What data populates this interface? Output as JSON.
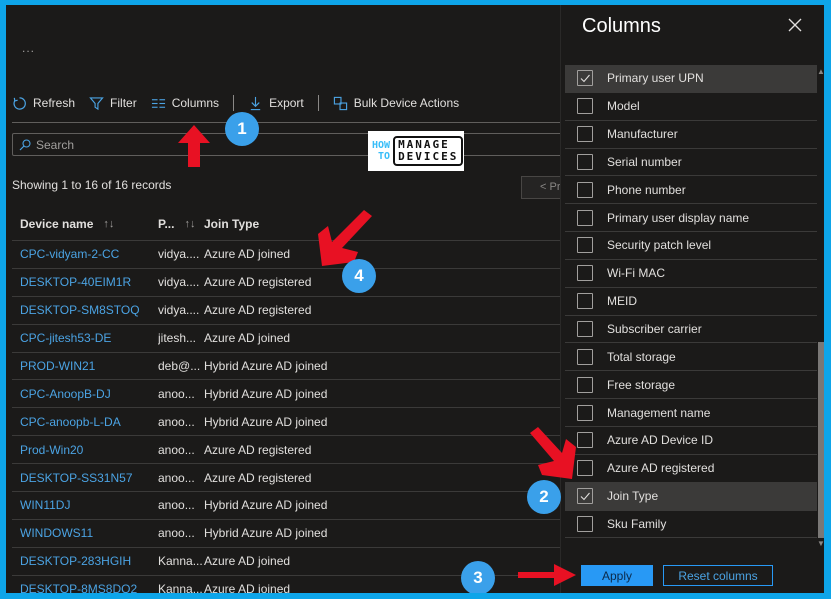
{
  "main": {
    "more_label": "...",
    "toolbar": {
      "refresh": "Refresh",
      "filter": "Filter",
      "columns": "Columns",
      "export": "Export",
      "bulk": "Bulk Device Actions"
    },
    "search_placeholder": "Search",
    "showing": "Showing 1 to 16 of 16 records",
    "prev_label": "< Pre",
    "logo": {
      "how": "HOW",
      "to": "TO",
      "manage": "MANAGE",
      "devices": "DEVICES"
    },
    "table": {
      "headers": [
        "Device name",
        "P...",
        "Join Type"
      ],
      "sort_glyph": "↑↓",
      "rows": [
        {
          "device": "CPC-vidyam-2-CC",
          "user": "vidya....",
          "join": "Azure AD joined"
        },
        {
          "device": "DESKTOP-40EIM1R",
          "user": "vidya....",
          "join": "Azure AD registered"
        },
        {
          "device": "DESKTOP-SM8STOQ",
          "user": "vidya....",
          "join": "Azure AD registered"
        },
        {
          "device": "CPC-jitesh53-DE",
          "user": "jitesh...",
          "join": "Azure AD joined"
        },
        {
          "device": "PROD-WIN21",
          "user": "deb@...",
          "join": "Hybrid Azure AD joined"
        },
        {
          "device": "CPC-AnoopB-DJ",
          "user": "anoo...",
          "join": "Hybrid Azure AD joined"
        },
        {
          "device": "CPC-anoopb-L-DA",
          "user": "anoo...",
          "join": "Hybrid Azure AD joined"
        },
        {
          "device": "Prod-Win20",
          "user": "anoo...",
          "join": "Azure AD registered"
        },
        {
          "device": "DESKTOP-SS31N57",
          "user": "anoo...",
          "join": "Azure AD registered"
        },
        {
          "device": "WIN11DJ",
          "user": "anoo...",
          "join": "Hybrid Azure AD joined"
        },
        {
          "device": "WINDOWS11",
          "user": "anoo...",
          "join": "Hybrid Azure AD joined"
        },
        {
          "device": "DESKTOP-283HGIH",
          "user": "Kanna...",
          "join": "Azure AD joined"
        },
        {
          "device": "DESKTOP-8MS8DQ2",
          "user": "Kanna...",
          "join": "Azure AD joined"
        }
      ]
    }
  },
  "panel": {
    "title": "Columns",
    "items": [
      {
        "label": "Primary user UPN",
        "checked": true
      },
      {
        "label": "Model",
        "checked": false
      },
      {
        "label": "Manufacturer",
        "checked": false
      },
      {
        "label": "Serial number",
        "checked": false
      },
      {
        "label": "Phone number",
        "checked": false
      },
      {
        "label": "Primary user display name",
        "checked": false
      },
      {
        "label": "Security patch level",
        "checked": false
      },
      {
        "label": "Wi-Fi MAC",
        "checked": false
      },
      {
        "label": "MEID",
        "checked": false
      },
      {
        "label": "Subscriber carrier",
        "checked": false
      },
      {
        "label": "Total storage",
        "checked": false
      },
      {
        "label": "Free storage",
        "checked": false
      },
      {
        "label": "Management name",
        "checked": false
      },
      {
        "label": "Azure AD Device ID",
        "checked": false
      },
      {
        "label": "Azure AD registered",
        "checked": false
      },
      {
        "label": "Join Type",
        "checked": true
      },
      {
        "label": "Sku Family",
        "checked": false
      }
    ],
    "apply": "Apply",
    "reset": "Reset columns"
  },
  "annotations": {
    "badges": [
      "1",
      "2",
      "3",
      "4"
    ],
    "arrow_color": "#e81123",
    "badge_color": "#3aa0ea"
  }
}
